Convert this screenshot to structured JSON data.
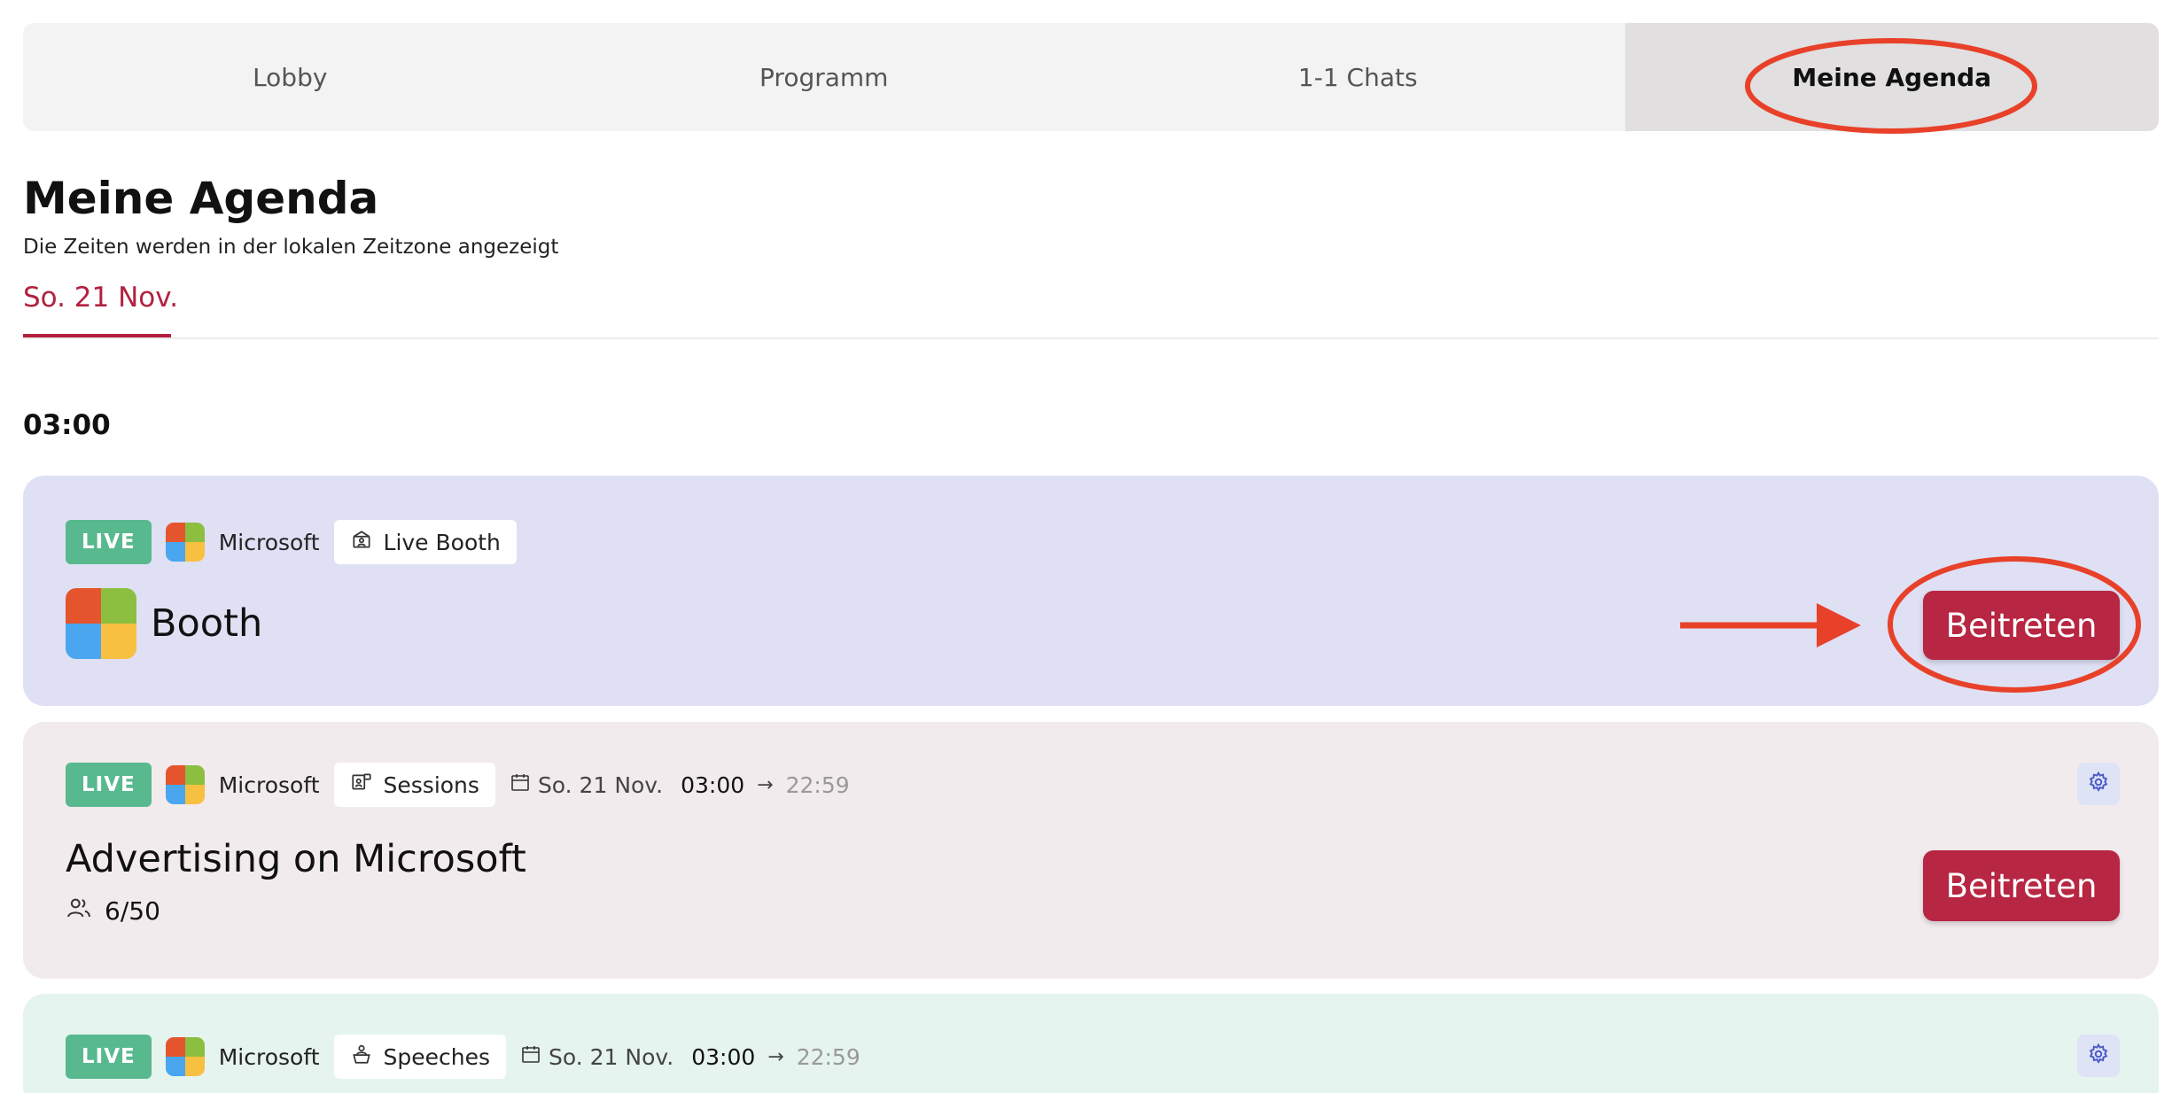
{
  "tabs": [
    {
      "label": "Lobby"
    },
    {
      "label": "Programm"
    },
    {
      "label": "1-1 Chats"
    },
    {
      "label": "Meine Agenda"
    }
  ],
  "page": {
    "title": "Meine Agenda",
    "subtitle": "Die Zeiten werden in der lokalen Zeitzone angezeigt",
    "date_tab": "So. 21 Nov.",
    "time_heading": "03:00"
  },
  "colors": {
    "accent": "#b72642",
    "live_badge": "#58b98e",
    "annotation": "#e8412a"
  },
  "cards": [
    {
      "live_label": "LIVE",
      "organization": "Microsoft",
      "type_label": "Live Booth",
      "type_icon": "booth-icon",
      "title": "Booth",
      "join_label": "Beitreten"
    },
    {
      "live_label": "LIVE",
      "organization": "Microsoft",
      "type_label": "Sessions",
      "type_icon": "sessions-icon",
      "date": "So. 21 Nov.",
      "start": "03:00",
      "end": "22:59",
      "title": "Advertising on Microsoft",
      "attendees": "6/50",
      "join_label": "Beitreten"
    },
    {
      "live_label": "LIVE",
      "organization": "Microsoft",
      "type_label": "Speeches",
      "type_icon": "speeches-icon",
      "date": "So. 21 Nov.",
      "start": "03:00",
      "end": "22:59"
    }
  ]
}
